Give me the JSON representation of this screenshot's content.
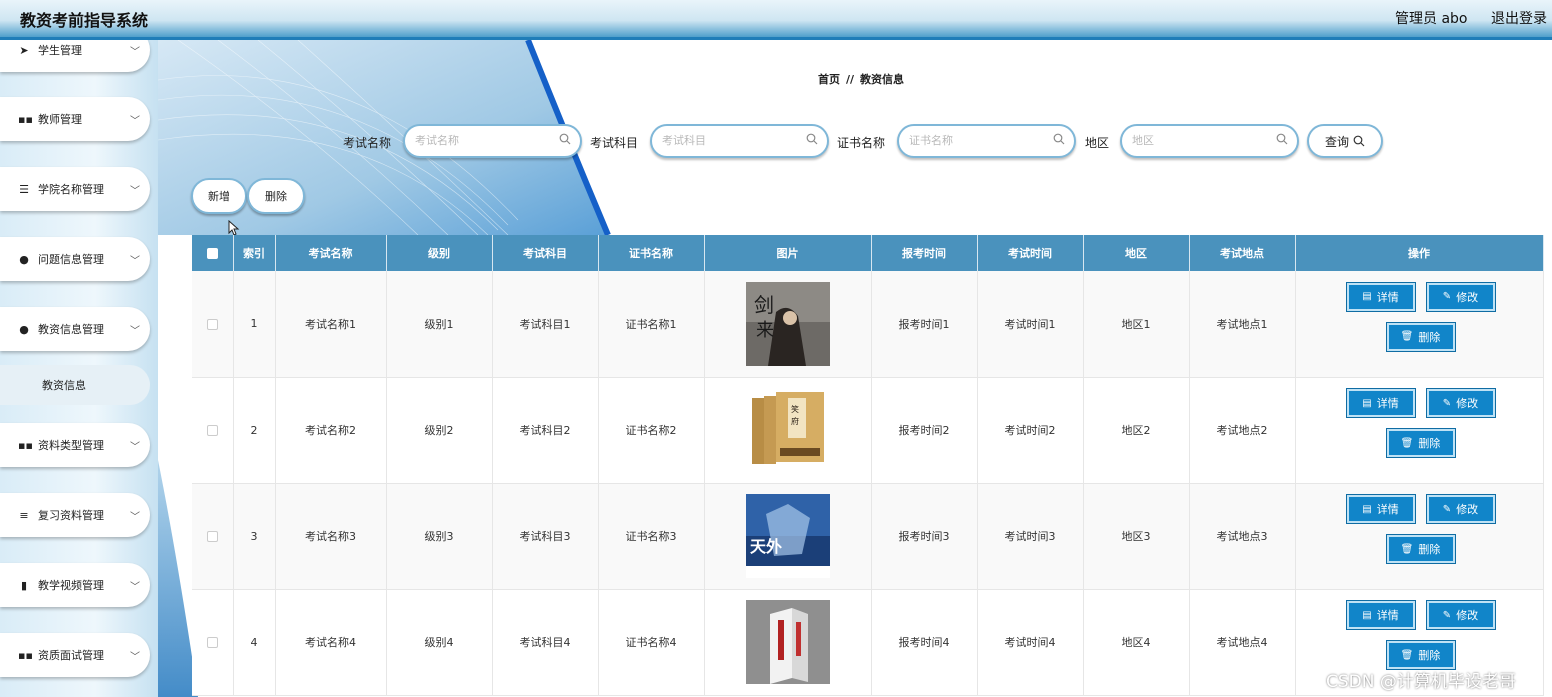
{
  "header": {
    "app_title": "教资考前指导系统",
    "user": "管理员 abo",
    "logout": "退出登录"
  },
  "sidebar": {
    "items": [
      {
        "label": "学生管理",
        "icon": "send-icon"
      },
      {
        "label": "教师管理",
        "icon": "grid-icon"
      },
      {
        "label": "学院名称管理",
        "icon": "sliders-icon"
      },
      {
        "label": "问题信息管理",
        "icon": "user-icon"
      },
      {
        "label": "教资信息管理",
        "icon": "user-icon"
      },
      {
        "label": "资料类型管理",
        "icon": "grid-icon"
      },
      {
        "label": "复习资料管理",
        "icon": "list-icon"
      },
      {
        "label": "教学视频管理",
        "icon": "bar-chart-icon"
      },
      {
        "label": "资质面试管理",
        "icon": "grid-icon"
      }
    ],
    "sub_item": "教资信息"
  },
  "breadcrumb": {
    "home": "首页",
    "sep": "//",
    "current": "教资信息"
  },
  "search": {
    "name_label": "考试名称",
    "name_placeholder": "考试名称",
    "subject_label": "考试科目",
    "subject_placeholder": "考试科目",
    "cert_label": "证书名称",
    "cert_placeholder": "证书名称",
    "region_label": "地区",
    "region_placeholder": "地区",
    "query_label": "查询"
  },
  "toolbar": {
    "add_label": "新增",
    "delete_label": "删除"
  },
  "table": {
    "headers": [
      "索引",
      "考试名称",
      "级别",
      "考试科目",
      "证书名称",
      "图片",
      "报考时间",
      "考试时间",
      "地区",
      "考试地点",
      "操作"
    ],
    "rows": [
      {
        "index": "1",
        "name": "考试名称1",
        "level": "级别1",
        "subject": "考试科目1",
        "cert": "证书名称1",
        "signup": "报考时间1",
        "exam_time": "考试时间1",
        "region": "地区1",
        "location": "考试地点1"
      },
      {
        "index": "2",
        "name": "考试名称2",
        "level": "级别2",
        "subject": "考试科目2",
        "cert": "证书名称2",
        "signup": "报考时间2",
        "exam_time": "考试时间2",
        "region": "地区2",
        "location": "考试地点2"
      },
      {
        "index": "3",
        "name": "考试名称3",
        "level": "级别3",
        "subject": "考试科目3",
        "cert": "证书名称3",
        "signup": "报考时间3",
        "exam_time": "考试时间3",
        "region": "地区3",
        "location": "考试地点3"
      },
      {
        "index": "4",
        "name": "考试名称4",
        "level": "级别4",
        "subject": "考试科目4",
        "cert": "证书名称4",
        "signup": "报考时间4",
        "exam_time": "考试时间4",
        "region": "地区4",
        "location": "考试地点4"
      }
    ],
    "actions": {
      "detail": "详情",
      "edit": "修改",
      "delete": "删除"
    }
  },
  "watermark": "CSDN @计算机毕设老哥",
  "colors": {
    "accent": "#1185c9",
    "table_header": "#4a92bd",
    "header_border": "#1f7db8"
  }
}
